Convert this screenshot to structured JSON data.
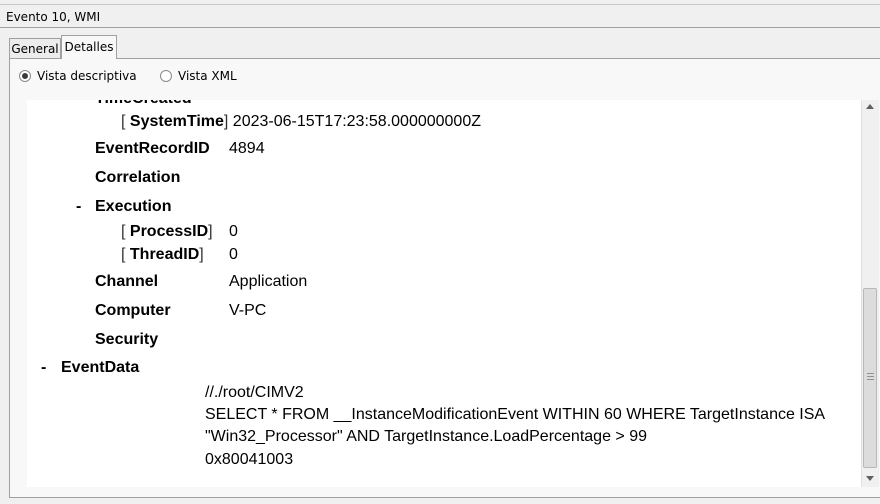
{
  "window": {
    "title": "Evento 10, WMI"
  },
  "tabs": {
    "general": "General",
    "details": "Detalles"
  },
  "view_options": {
    "friendly": "Vista descriptiva",
    "xml": "Vista XML",
    "selected": "friendly"
  },
  "tree": {
    "time_created": "TimeCreated",
    "system_time_key": "SystemTime",
    "system_time_value": "2023-06-15T17:23:58.000000000Z",
    "event_record_id_key": "EventRecordID",
    "event_record_id_value": "4894",
    "correlation_key": "Correlation",
    "execution_toggle": "-",
    "execution_key": "Execution",
    "process_id_key": "ProcessID",
    "process_id_value": "0",
    "thread_id_key": "ThreadID",
    "thread_id_value": "0",
    "channel_key": "Channel",
    "channel_value": "Application",
    "computer_key": "Computer",
    "computer_value": "V-PC",
    "security_key": "Security",
    "eventdata_toggle": "-",
    "eventdata_key": "EventData",
    "eventdata_line1": "//./root/CIMV2",
    "eventdata_line2": "SELECT * FROM __InstanceModificationEvent WITHIN 60 WHERE TargetInstance ISA",
    "eventdata_line3": "\"Win32_Processor\" AND TargetInstance.LoadPercentage > 99",
    "eventdata_line4": "0x80041003"
  },
  "brackets": {
    "open": "[",
    "close": "]"
  }
}
